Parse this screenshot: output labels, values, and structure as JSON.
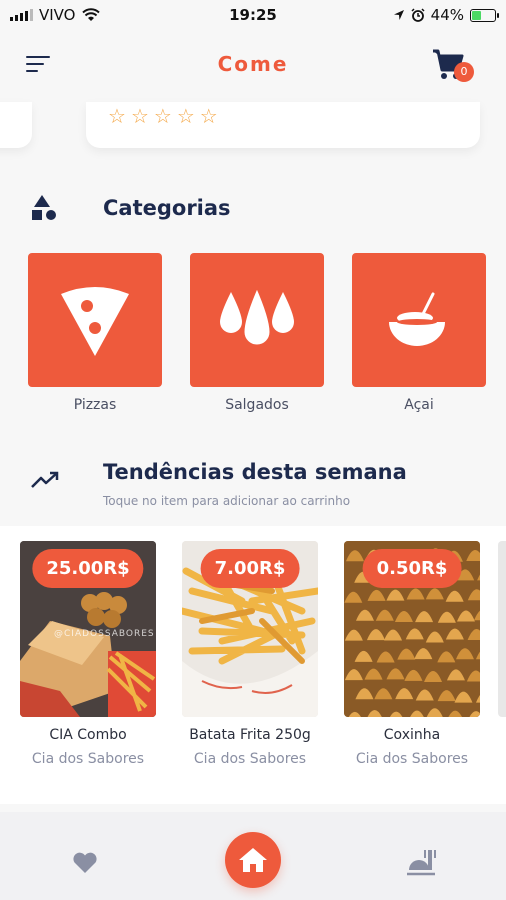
{
  "status_bar": {
    "carrier": "VIVO",
    "time": "19:25",
    "battery": "44%",
    "battery_level": 0.44
  },
  "header": {
    "title": "Come",
    "cart_count": "0"
  },
  "rating": {
    "stars": 5
  },
  "categories_section": {
    "title": "Categorias",
    "items": [
      {
        "label": "Pizzas"
      },
      {
        "label": "Salgados"
      },
      {
        "label": "Açai"
      }
    ]
  },
  "trending_section": {
    "title": "Tendências desta semana",
    "subtitle": "Toque no item para adicionar ao carrinho",
    "products": [
      {
        "price": "25.00R$",
        "name": "CIA Combo",
        "store": "Cia dos Sabores",
        "watermark": "@CIADOSSABORES"
      },
      {
        "price": "7.00R$",
        "name": "Batata Frita 250g",
        "store": "Cia dos Sabores"
      },
      {
        "price": "0.50R$",
        "name": "Coxinha",
        "store": "Cia dos Sabores"
      }
    ]
  },
  "colors": {
    "accent": "#ee5a3c",
    "navy": "#1d2a4d",
    "star": "#f4a94b"
  }
}
